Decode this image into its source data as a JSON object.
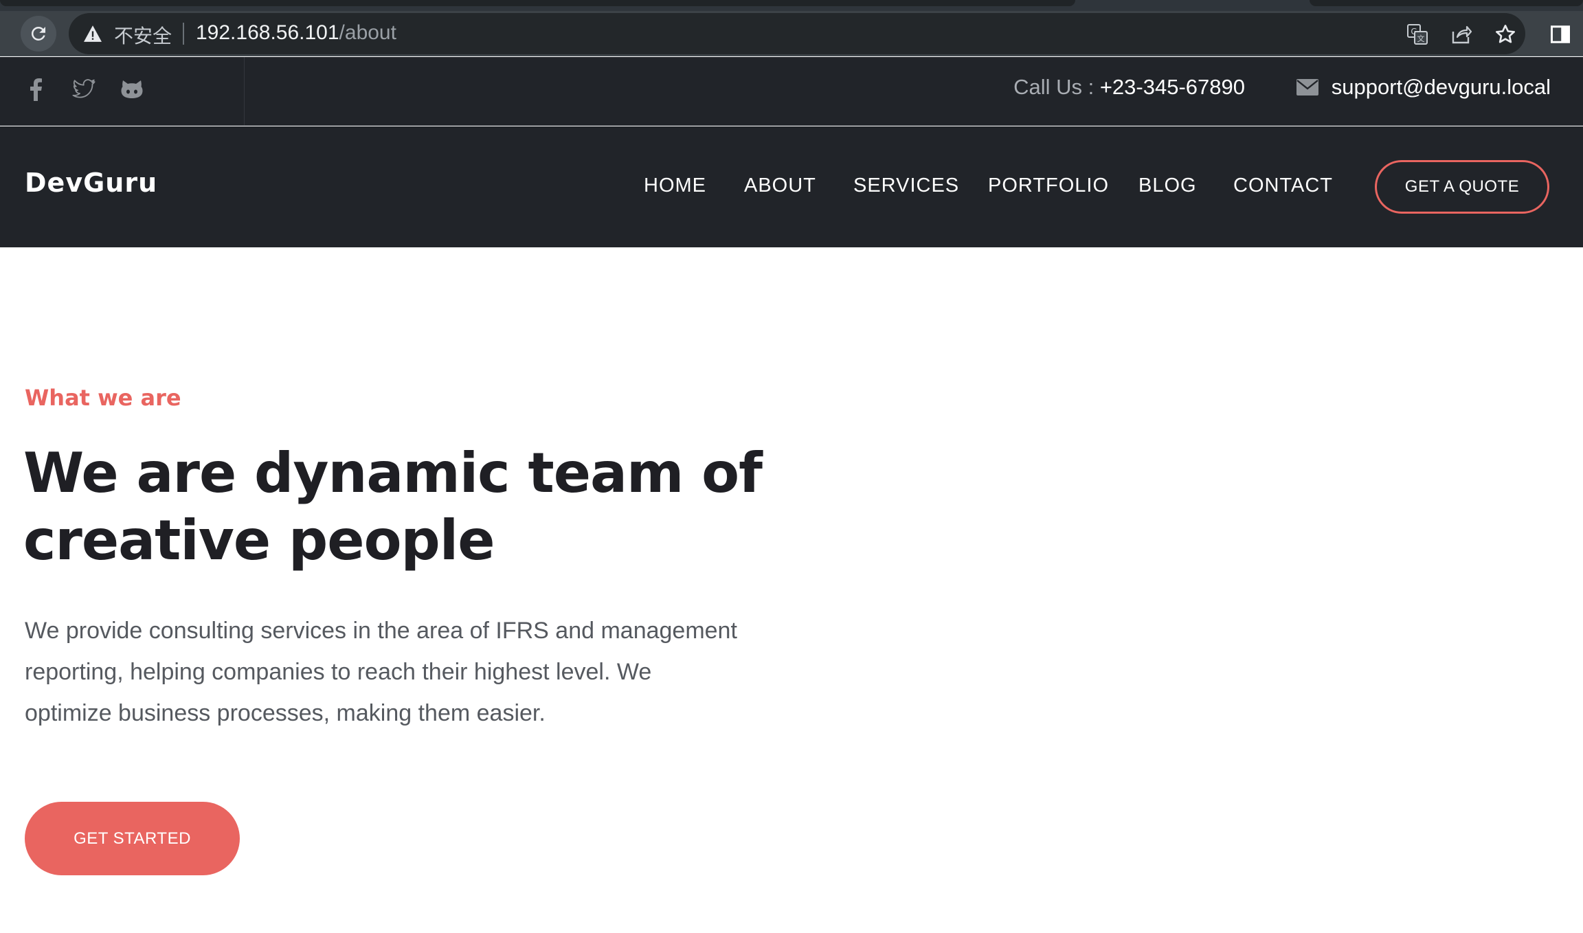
{
  "browser": {
    "insecure_label": "不安全",
    "url_host": "192.168.56.101",
    "url_path": "/about",
    "icons": [
      "reload-icon",
      "warning-icon",
      "translate-icon",
      "share-icon",
      "bookmark-star-icon",
      "side-panel-icon"
    ]
  },
  "topbar": {
    "social_icons": [
      "facebook-icon",
      "twitter-icon",
      "github-icon"
    ],
    "call_label": "Call Us : ",
    "phone": "+23-345-67890",
    "email": "support@devguru.local"
  },
  "nav": {
    "brand": "DevGuru",
    "links": [
      "HOME",
      "ABOUT",
      "SERVICES",
      "PORTFOLIO",
      "BLOG",
      "CONTACT"
    ],
    "quote_button": "GET A QUOTE"
  },
  "hero": {
    "kicker": "What we are",
    "title": "We are dynamic team of creative people",
    "text": "We provide consulting services in the area of IFRS and management reporting, helping companies to reach their highest level. We optimize business processes, making them easier.",
    "button": "GET STARTED"
  },
  "colors": {
    "accent": "#e96560",
    "dark": "#212429",
    "chrome": "#3c4247"
  }
}
